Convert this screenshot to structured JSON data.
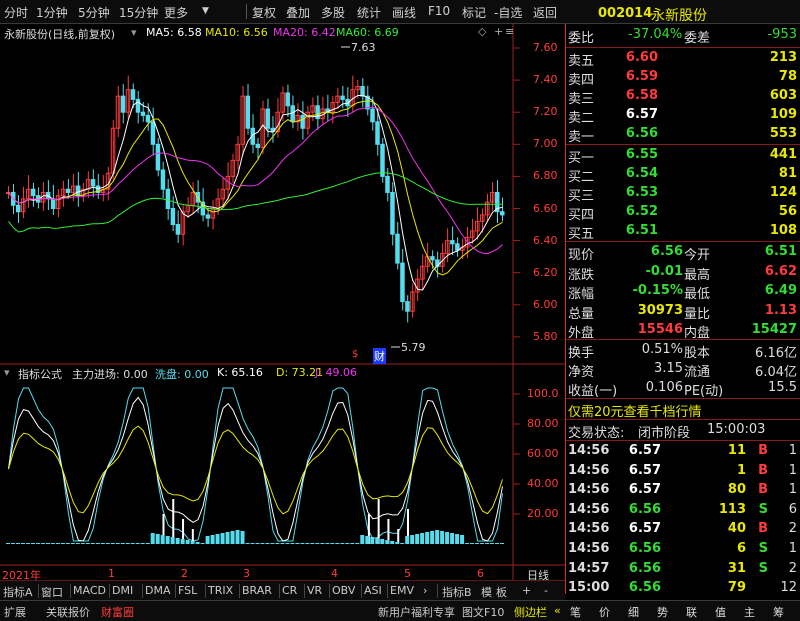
{
  "toolbar": {
    "left_items": [
      "分时",
      "1分钟",
      "5分钟",
      "15分钟",
      "更多"
    ],
    "right_items": [
      "复权",
      "叠加",
      "多股",
      "统计",
      "画线",
      "F10",
      "标记",
      "-自选",
      "返回"
    ]
  },
  "chart": {
    "stock_title": "永新股份(日线,前复权)",
    "ma5": "MA5: 6.58",
    "ma10": "MA10: 6.56",
    "ma20": "MA20: 6.42",
    "ma60": "MA60: 6.69",
    "high_mark": "7.63",
    "low_mark": "5.79",
    "marker_s": "$",
    "marker_cai": "财",
    "price_ticks": [
      "7.60",
      "7.40",
      "7.20",
      "7.00",
      "6.80",
      "6.60",
      "6.40",
      "6.20",
      "6.00",
      "5.80"
    ],
    "indicator_title": "指标公式",
    "indicator_name": "主力进场: 0.00",
    "xipan": "洗盘: 0.00",
    "k_val": "K: 65.16",
    "d_val": "D: 73.21",
    "j_val": "J: 49.06",
    "ind_ticks": [
      "100.0",
      "80.00",
      "60.00",
      "40.00",
      "20.00"
    ],
    "year_label": "2021年",
    "months": [
      "2",
      "3",
      "4",
      "5",
      "6"
    ],
    "months_first": "1",
    "period": "日线"
  },
  "bottom_tabs": [
    "指标A",
    "窗口",
    "MACD",
    "DMI",
    "DMA",
    "FSL",
    "TRIX",
    "BRAR",
    "CR",
    "VR",
    "OBV",
    "ASI",
    "EMV"
  ],
  "bottom_tabs_right": [
    "指标B",
    "模",
    "板",
    "+",
    "-"
  ],
  "status_left": [
    "扩展",
    "关联报价",
    "财富圈"
  ],
  "status_right": [
    "新用户福利专享",
    "图文F10",
    "侧边栏"
  ],
  "side_buttons": [
    "笔",
    "价",
    "细",
    "势",
    "联",
    "值",
    "主",
    "筹"
  ],
  "quote": {
    "code": "002014",
    "name": "永新股份",
    "weibi_label": "委比",
    "weibi": "-37.04%",
    "weicha_label": "委差",
    "weicha": "-953",
    "asks": [
      {
        "label": "卖五",
        "price": "6.60",
        "vol": "213"
      },
      {
        "label": "卖四",
        "price": "6.59",
        "vol": "78"
      },
      {
        "label": "卖三",
        "price": "6.58",
        "vol": "603"
      },
      {
        "label": "卖二",
        "price": "6.57",
        "vol": "109"
      },
      {
        "label": "卖一",
        "price": "6.56",
        "vol": "553"
      }
    ],
    "bids": [
      {
        "label": "买一",
        "price": "6.55",
        "vol": "441"
      },
      {
        "label": "买二",
        "price": "6.54",
        "vol": "81"
      },
      {
        "label": "买三",
        "price": "6.53",
        "vol": "124"
      },
      {
        "label": "买四",
        "price": "6.52",
        "vol": "56"
      },
      {
        "label": "买五",
        "price": "6.51",
        "vol": "108"
      }
    ],
    "stats": [
      {
        "l1": "现价",
        "v1": "6.56",
        "l2": "今开",
        "v2": "6.51"
      },
      {
        "l1": "涨跌",
        "v1": "-0.01",
        "l2": "最高",
        "v2": "6.62"
      },
      {
        "l1": "涨幅",
        "v1": "-0.15%",
        "l2": "最低",
        "v2": "6.49"
      },
      {
        "l1": "总量",
        "v1": "30973",
        "l2": "量比",
        "v2": "1.13"
      },
      {
        "l1": "外盘",
        "v1": "15546",
        "l2": "内盘",
        "v2": "15427"
      }
    ],
    "stats2": [
      {
        "l1": "换手",
        "v1": "0.51%",
        "l2": "股本",
        "v2": "6.16亿"
      },
      {
        "l1": "净资",
        "v1": "3.15",
        "l2": "流通",
        "v2": "6.04亿"
      },
      {
        "l1": "收益(一)",
        "v1": "0.106",
        "l2": "PE(动)",
        "v2": "15.5"
      }
    ],
    "promo": "仅需20元查看千档行情",
    "trade_state_label": "交易状态:",
    "trade_state": "闭市阶段",
    "trade_time": "15:00:03",
    "ticks": [
      {
        "t": "14:56",
        "p": "6.57",
        "v": "11",
        "bs": "B",
        "n": "1"
      },
      {
        "t": "14:56",
        "p": "6.57",
        "v": "1",
        "bs": "B",
        "n": "1"
      },
      {
        "t": "14:56",
        "p": "6.57",
        "v": "80",
        "bs": "B",
        "n": "1"
      },
      {
        "t": "14:56",
        "p": "6.56",
        "v": "113",
        "bs": "S",
        "n": "6"
      },
      {
        "t": "14:56",
        "p": "6.57",
        "v": "40",
        "bs": "B",
        "n": "2"
      },
      {
        "t": "14:56",
        "p": "6.56",
        "v": "6",
        "bs": "S",
        "n": "1"
      },
      {
        "t": "14:57",
        "p": "6.56",
        "v": "31",
        "bs": "S",
        "n": "2"
      },
      {
        "t": "15:00",
        "p": "6.56",
        "v": "79",
        "bs": "",
        "n": "12"
      }
    ]
  },
  "colors": {
    "red": "#ff3b3b",
    "green": "#33dd33",
    "yellow": "#e8e800",
    "white": "#ffffff",
    "cyan": "#55ddee",
    "magenta": "#ee33ee",
    "bggreen": "#33ee33"
  }
}
